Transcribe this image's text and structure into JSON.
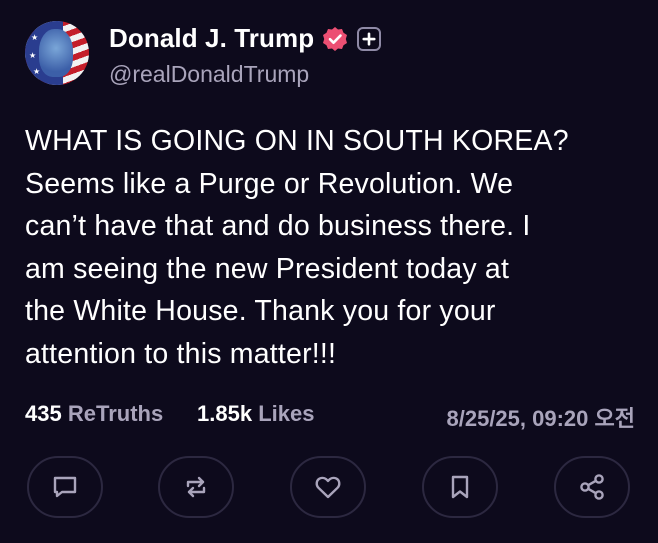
{
  "post": {
    "author": {
      "name": "Donald J. Trump",
      "handle": "@realDonaldTrump",
      "verified_icon": "verified-badge-icon",
      "extra_badge_icon": "plus-badge-icon",
      "verified_color": "#ec4f73"
    },
    "text": "WHAT IS GOING ON IN SOUTH KOREA?\nSeems like a Purge or Revolution. We\ncan’t have that and do business there. I\nam seeing the new President today at\nthe White House. Thank you for your\nattention to this matter!!!",
    "stats": {
      "retruths_count": "435",
      "retruths_label": "ReTruths",
      "likes_count": "1.85k",
      "likes_label": "Likes",
      "timestamp": "8/25/25, 09:20 오전"
    },
    "actions": [
      {
        "name": "reply",
        "icon": "comment-icon"
      },
      {
        "name": "retruth",
        "icon": "repost-icon"
      },
      {
        "name": "like",
        "icon": "heart-icon"
      },
      {
        "name": "bookmark",
        "icon": "bookmark-icon"
      },
      {
        "name": "share",
        "icon": "share-icon"
      }
    ]
  },
  "colors": {
    "background": "#0d0a1c",
    "text_primary": "#ffffff",
    "text_secondary": "#a9a4bb",
    "button_border": "#2c2840"
  }
}
